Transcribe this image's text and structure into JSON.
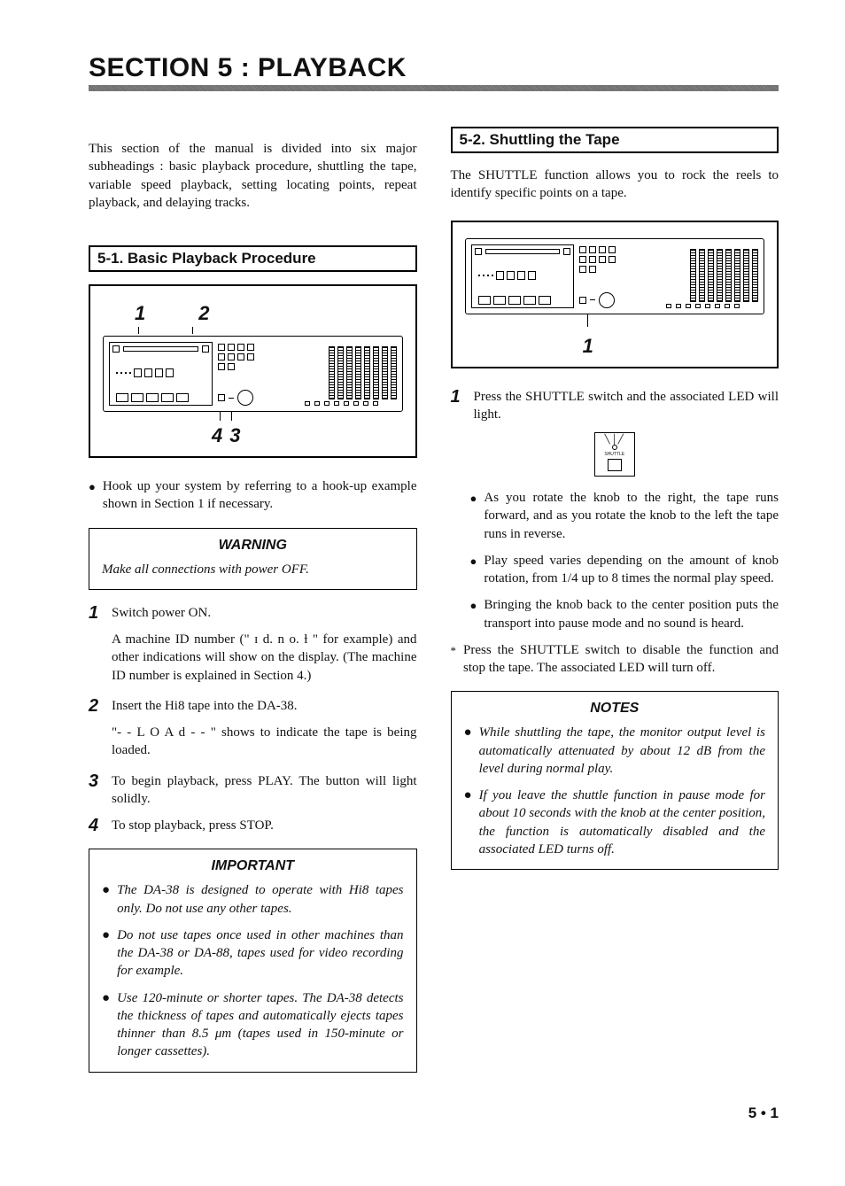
{
  "sectionTitle": "SECTION 5 :  PLAYBACK",
  "intro": "This section of the manual is divided into six major subheadings : basic playback procedure, shuttling the tape, variable speed playback, setting locating points, repeat playback, and delaying tracks.",
  "left": {
    "subhead": "5-1. Basic Playback Procedure",
    "callouts": {
      "top": [
        "1",
        "2"
      ],
      "bottom": [
        "4",
        "3"
      ]
    },
    "hookup": "Hook up your system by referring to a hook-up example shown in Section 1 if necessary.",
    "warning": {
      "header": "WARNING",
      "body": "Make all connections with power OFF."
    },
    "steps": [
      {
        "num": "1",
        "text": "Switch power ON.",
        "sub": "A machine ID number (\" ɪ d.  n o.   ƚ \" for example) and other indications will show on the display. (The machine ID number is explained in Section 4.)"
      },
      {
        "num": "2",
        "text": "Insert the Hi8 tape into the DA-38.",
        "sub": "\"- - L O A d - - \" shows to indicate the tape is being loaded."
      },
      {
        "num": "3",
        "text": "To begin playback, press PLAY. The button will light solidly."
      },
      {
        "num": "4",
        "text": "To stop playback, press STOP."
      }
    ],
    "important": {
      "header": "IMPORTANT",
      "items": [
        "The DA-38 is designed to operate with Hi8 tapes only. Do not use any other tapes.",
        "Do not use tapes once used in other machines than the DA-38 or DA-88, tapes used for video recording for example.",
        "Use 120-minute or shorter tapes. The DA-38 detects the thickness of tapes and automatically ejects tapes thinner than 8.5 μm (tapes used in 150-minute or longer cassettes)."
      ]
    }
  },
  "right": {
    "subhead": "5-2. Shuttling the Tape",
    "intro": "The SHUTTLE function allows you to rock the reels to identify specific points on a tape.",
    "callout": "1",
    "step1": "Press the SHUTTLE switch and the associated LED will light.",
    "iconLabel": "SHUTTLE",
    "subbullets": [
      "As you rotate the knob to the right, the tape runs forward, and as you rotate the knob to the left the tape runs in reverse.",
      "Play speed varies depending on the amount of knob rotation, from 1/4 up to 8 times the normal play speed.",
      "Bringing the knob back to the center position puts the transport into pause mode and no sound is heard."
    ],
    "star": "Press the SHUTTLE switch to disable the function and stop the tape. The associated LED will turn off.",
    "notes": {
      "header": "NOTES",
      "items": [
        "While shuttling the tape, the monitor output level is automatically attenuated by about 12 dB from the level during normal play.",
        "If you leave the shuttle function in pause mode for about 10 seconds with the knob at the center position, the function is automatically disabled and the associated LED turns off."
      ]
    }
  },
  "pageNum": "5 • 1"
}
